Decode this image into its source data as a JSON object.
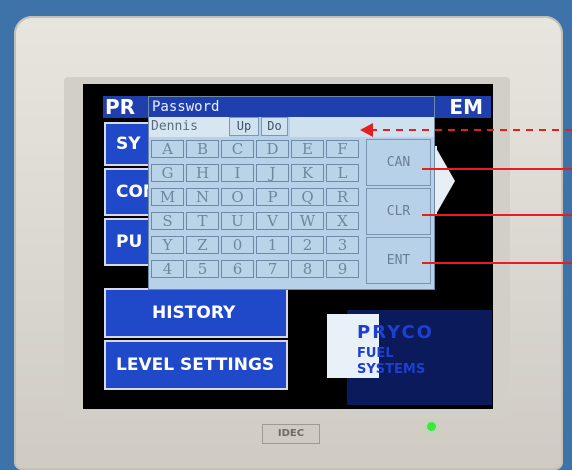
{
  "title_bar": {
    "left_text": "PR",
    "right_text": "EM"
  },
  "password_dialog": {
    "title": "Password",
    "user_field": "Dennis",
    "up_label": "Up",
    "down_label": "Do",
    "keys": [
      "A",
      "B",
      "C",
      "D",
      "E",
      "F",
      "G",
      "H",
      "I",
      "J",
      "K",
      "L",
      "M",
      "N",
      "O",
      "P",
      "Q",
      "R",
      "S",
      "T",
      "U",
      "V",
      "W",
      "X",
      "Y",
      "Z",
      "0",
      "1",
      "2",
      "3",
      "4",
      "5",
      "6",
      "7",
      "8",
      "9"
    ],
    "actions": [
      "CAN",
      "CLR",
      "ENT"
    ]
  },
  "menu": {
    "sys_label": "SY",
    "con_label": "CON",
    "pu_label": "PU",
    "history_label": "HISTORY",
    "level_settings_label": "LEVEL SETTINGS"
  },
  "brand": {
    "line1": "PRYCO",
    "line2": "FUEL",
    "line3": "SYSTEMS"
  },
  "device": {
    "badge": "IDEC"
  },
  "colors": {
    "accent": "#1f49c9",
    "annotation": "#e61e1e",
    "led": "#3de63d"
  }
}
